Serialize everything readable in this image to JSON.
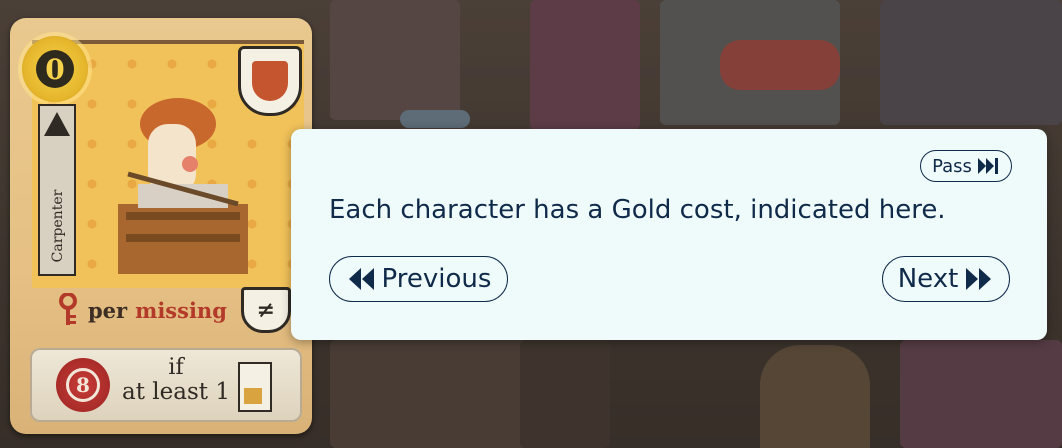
{
  "card": {
    "cost": "0",
    "character_name": "Carpenter",
    "ability": {
      "per": "per",
      "missing": "missing"
    },
    "condition": {
      "value": "8",
      "line1": "if",
      "line2": "at least 1"
    }
  },
  "tutorial": {
    "message": "Each character has a Gold cost, indicated here.",
    "pass_label": "Pass",
    "previous_label": "Previous",
    "next_label": "Next"
  },
  "colors": {
    "dialog_bg": "#effbfa",
    "dialog_text": "#102a4a",
    "gold": "#e5b62c",
    "red": "#b33a2b"
  }
}
